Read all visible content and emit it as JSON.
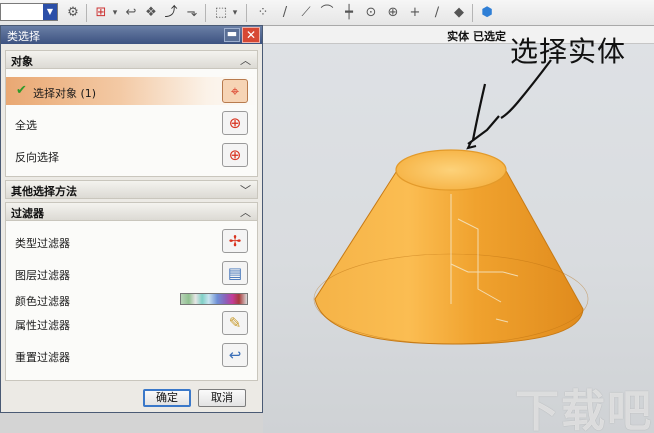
{
  "toolbar": {
    "combo_value": "",
    "icons": [
      "filter-icon",
      "select-icon",
      "undo-icon",
      "part-icon",
      "line-icon",
      "snap-icon",
      "box-select-icon",
      "snap-endpoint-icon",
      "snap-line-icon",
      "snap-arc-icon",
      "snap-plus-icon",
      "snap-circle-icon",
      "snap-center-icon",
      "snap-add-icon",
      "snap-slash-icon",
      "snap-point-icon",
      "cube-icon"
    ]
  },
  "viewport": {
    "status_text": "实体 已选定"
  },
  "dialog": {
    "title": "类选择",
    "sections": {
      "object": {
        "label": "对象",
        "rows": [
          {
            "label": "选择对象 (1)",
            "selected": true
          },
          {
            "label": "全选"
          },
          {
            "label": "反向选择"
          }
        ]
      },
      "other_methods": {
        "label": "其他选择方法"
      },
      "filters": {
        "label": "过滤器",
        "rows": [
          {
            "label": "类型过滤器"
          },
          {
            "label": "图层过滤器"
          },
          {
            "label": "颜色过滤器"
          },
          {
            "label": "属性过滤器"
          },
          {
            "label": "重置过滤器"
          }
        ]
      }
    },
    "buttons": {
      "ok": "确定",
      "cancel": "取消"
    }
  },
  "annotation": {
    "text": "选择实体"
  },
  "watermark": {
    "text": "下载吧"
  },
  "colors": {
    "dialog_title_bar": "#3d5280",
    "selection_highlight": "#e9a873",
    "cone_fill": "#f3a93a",
    "cone_top": "#fbc35c"
  }
}
